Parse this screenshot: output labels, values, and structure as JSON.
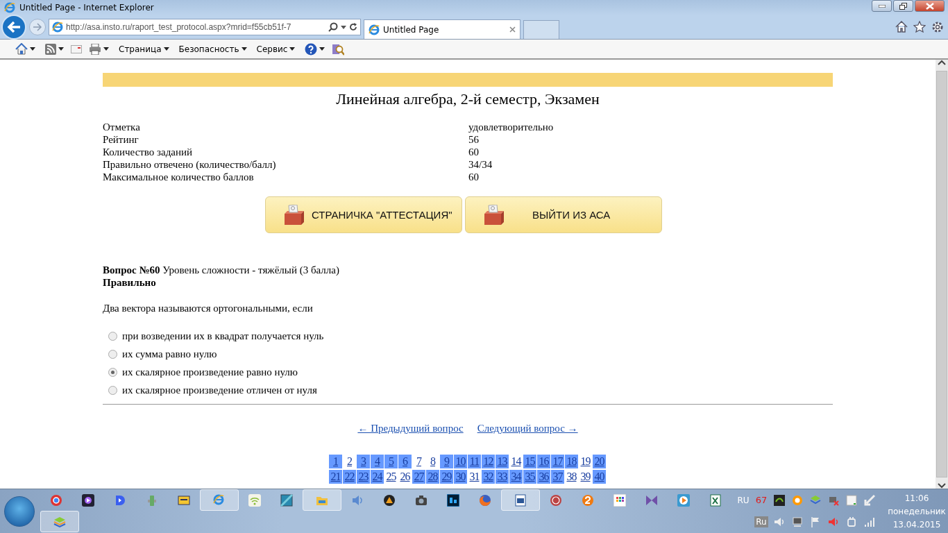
{
  "window": {
    "title": "Untitled Page - Internet Explorer"
  },
  "address_bar": {
    "url": "http://asa.insto.ru/raport_test_protocol.aspx?mrid=f55cb51f-7"
  },
  "tabs": [
    {
      "label": "Untitled Page",
      "selected": true
    }
  ],
  "command_bar": {
    "menus": [
      "Страница",
      "Безопасность",
      "Сервис"
    ]
  },
  "page": {
    "title": "Линейная алгебра, 2-й семестр, Экзамен",
    "summary": [
      {
        "label": "Отметка",
        "value": "удовлетворительно"
      },
      {
        "label": "Рейтинг",
        "value": "56"
      },
      {
        "label": "Количество заданий",
        "value": "60"
      },
      {
        "label": "Правильно отвечено (количество/балл)",
        "value": "34/34"
      },
      {
        "label": "Максимальное количество баллов",
        "value": "60"
      }
    ],
    "buttons": [
      "СТРАНИЧКА \"АТТЕСТАЦИЯ\"",
      "ВЫЙТИ ИЗ АСА"
    ],
    "question": {
      "heading": "**Вопрос №60** Уровень сложности - тяжёлый (3 балла)",
      "result": "Правильно",
      "text": "Два вектора называются ортогональными, если",
      "options": [
        {
          "label": "при возведении их в квадрат получается нуль",
          "selected": false
        },
        {
          "label": "их сумма равно нулю",
          "selected": false
        },
        {
          "label": "их скалярное произведение равно нулю",
          "selected": true
        },
        {
          "label": "их скалярное произведение отличен от нуля",
          "selected": false
        }
      ]
    },
    "nav": {
      "prev": "← Предыдущий вопрос",
      "next": "Следующий вопрос →"
    },
    "question_grid": [
      {
        "label": "1",
        "correct": true
      },
      {
        "label": "2",
        "correct": false
      },
      {
        "label": "3",
        "correct": true
      },
      {
        "label": "4",
        "correct": true
      },
      {
        "label": "5",
        "correct": true
      },
      {
        "label": "6",
        "correct": true
      },
      {
        "label": "7",
        "correct": false
      },
      {
        "label": "8",
        "correct": false
      },
      {
        "label": "9",
        "correct": true
      },
      {
        "label": "10",
        "correct": true
      },
      {
        "label": "11",
        "correct": true
      },
      {
        "label": "12",
        "correct": true
      },
      {
        "label": "13",
        "correct": true
      },
      {
        "label": "14",
        "correct": false
      },
      {
        "label": "15",
        "correct": true
      },
      {
        "label": "16",
        "correct": true
      },
      {
        "label": "17",
        "correct": true
      },
      {
        "label": "18",
        "correct": true
      },
      {
        "label": "19",
        "correct": false
      },
      {
        "label": "20",
        "correct": true
      },
      {
        "label": "21",
        "correct": true
      },
      {
        "label": "22",
        "correct": true
      },
      {
        "label": "23",
        "correct": true
      },
      {
        "label": "24",
        "correct": true
      },
      {
        "label": "25",
        "correct": false
      },
      {
        "label": "26",
        "correct": false
      },
      {
        "label": "27",
        "correct": true
      },
      {
        "label": "28",
        "correct": true
      },
      {
        "label": "29",
        "correct": true
      },
      {
        "label": "30",
        "correct": true
      },
      {
        "label": "31",
        "correct": false
      },
      {
        "label": "32",
        "correct": true
      },
      {
        "label": "33",
        "correct": true
      },
      {
        "label": "34",
        "correct": true
      },
      {
        "label": "35",
        "correct": true
      },
      {
        "label": "36",
        "correct": true
      },
      {
        "label": "37",
        "correct": true
      },
      {
        "label": "38",
        "correct": false
      },
      {
        "label": "39",
        "correct": false
      },
      {
        "label": "40",
        "correct": true
      }
    ]
  },
  "taskbar": {
    "tray": {
      "language": "RU",
      "counter": "67",
      "input_indicator": "Ru",
      "time": "11:06",
      "day": "понедельник",
      "date": "13.04.2015"
    }
  }
}
